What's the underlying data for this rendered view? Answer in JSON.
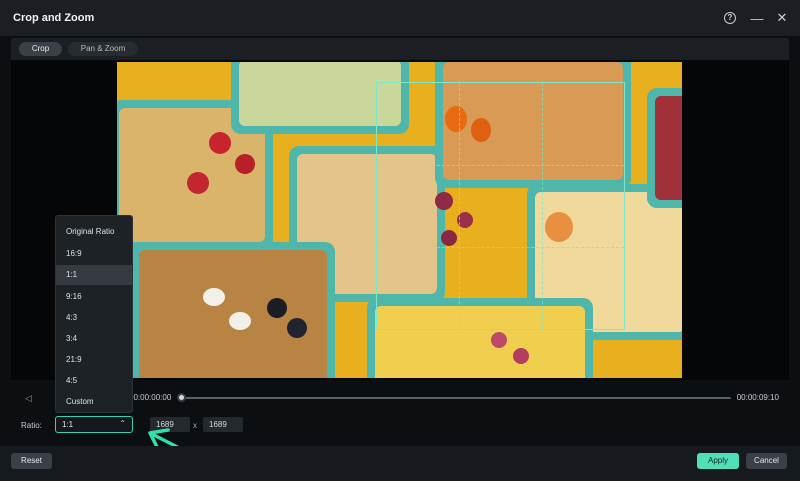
{
  "window": {
    "title": "Crop and Zoom"
  },
  "tabs": [
    {
      "label": "Crop"
    },
    {
      "label": "Pan & Zoom"
    }
  ],
  "timeline": {
    "start": "00:00:00:00",
    "end": "00:00:09:10"
  },
  "ratio": {
    "label": "Ratio:",
    "selected": "1:1",
    "options": [
      "Original Ratio",
      "16:9",
      "1:1",
      "9:16",
      "4:3",
      "3:4",
      "21:9",
      "4:5",
      "Custom"
    ],
    "width": "1689",
    "times": "x",
    "height": "1689"
  },
  "buttons": {
    "reset": "Reset",
    "apply": "Apply",
    "cancel": "Cancel"
  },
  "colors": {
    "accent": "#4fe0b8",
    "crop_frame": "#7fe6c8",
    "container": "#4fb6ac",
    "background_photo": "#e8b01e"
  },
  "icons": [
    "help-icon",
    "minimize-icon",
    "close-icon",
    "previous-frame-icon",
    "chevron-down-icon",
    "arrow-annotation-icon"
  ]
}
